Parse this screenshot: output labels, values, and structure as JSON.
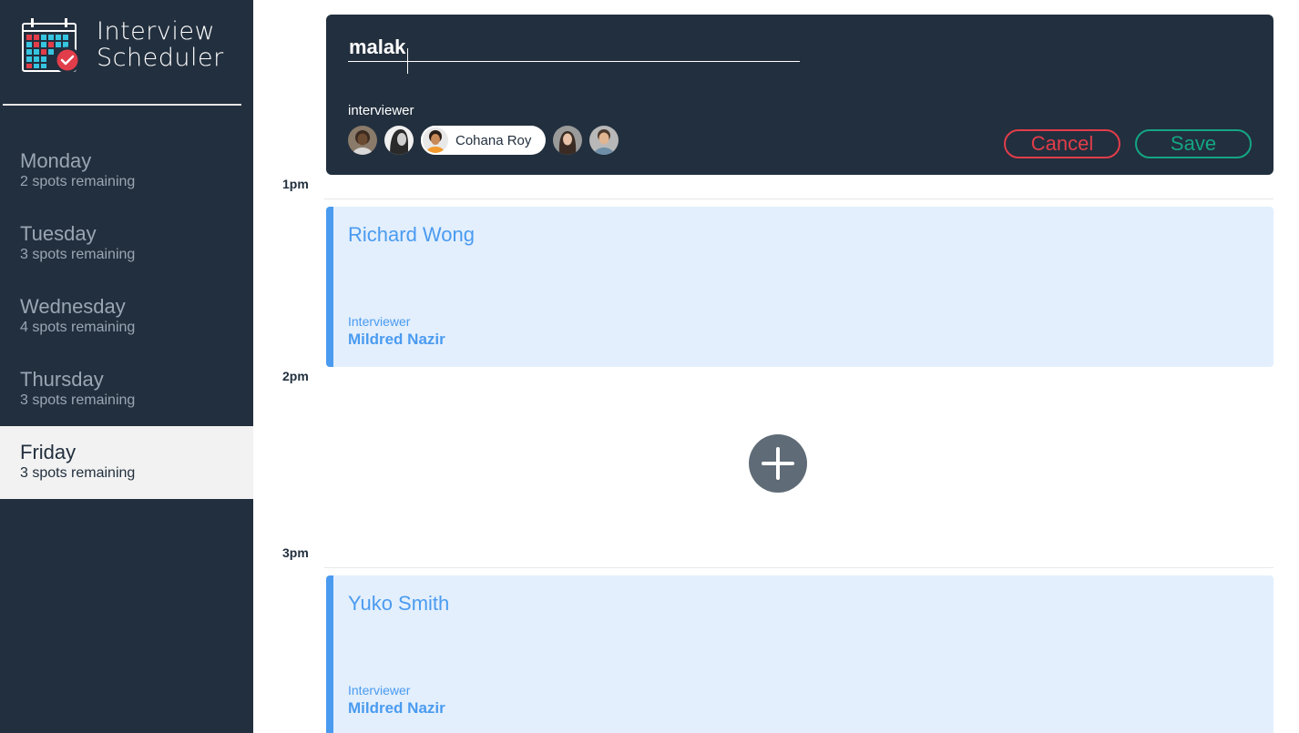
{
  "app": {
    "title_line1": "Interview",
    "title_line2": "Scheduler",
    "icon": "calendar-check-icon"
  },
  "days": [
    {
      "name": "Monday",
      "spots": "2 spots remaining",
      "selected": false
    },
    {
      "name": "Tuesday",
      "spots": "3 spots remaining",
      "selected": false
    },
    {
      "name": "Wednesday",
      "spots": "4 spots remaining",
      "selected": false
    },
    {
      "name": "Thursday",
      "spots": "3 spots remaining",
      "selected": false
    },
    {
      "name": "Friday",
      "spots": "3 spots remaining",
      "selected": true
    }
  ],
  "times": [
    "1pm",
    "2pm",
    "3pm"
  ],
  "form": {
    "student_value": "malak",
    "interviewer_label": "interviewer",
    "selected_interviewer": "Cohana Roy",
    "cancel_label": "Cancel",
    "save_label": "Save"
  },
  "appointments": [
    {
      "student": "Richard Wong",
      "interviewer_label": "Interviewer",
      "interviewer": "Mildred Nazir"
    },
    {
      "student": "Yuko Smith",
      "interviewer_label": "Interviewer",
      "interviewer": "Mildred Nazir"
    }
  ],
  "add": {
    "icon": "plus-icon"
  },
  "colors": {
    "sidebar": "#222f3e",
    "accent_blue": "#4a9bf0",
    "card_bg": "#e3effd",
    "danger": "#e23d4a",
    "success": "#14a683",
    "add_button": "#5f6b76"
  }
}
